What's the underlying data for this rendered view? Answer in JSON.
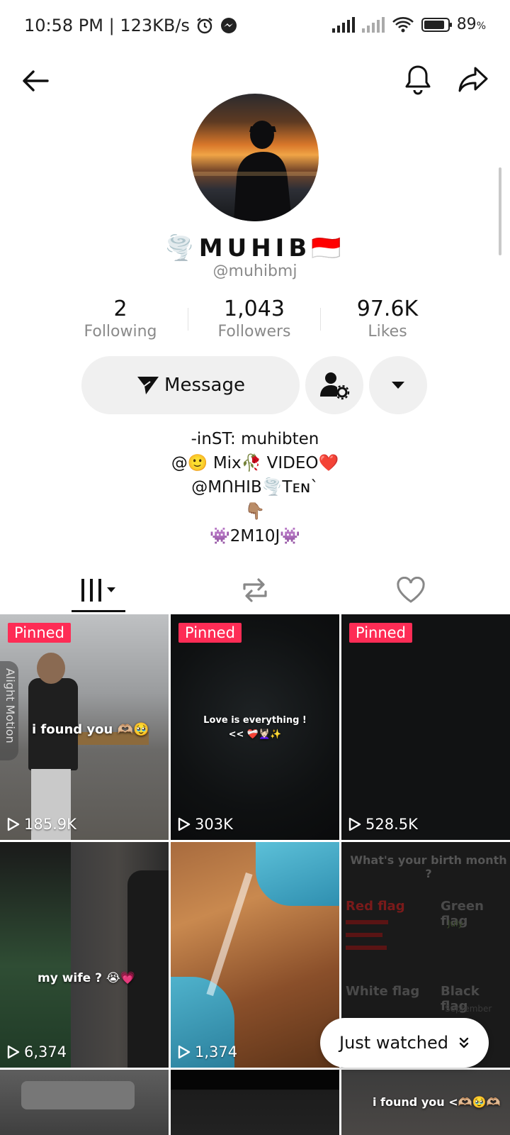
{
  "status_bar": {
    "time_speed": "10:58 PM | 123KB/s",
    "battery": "89",
    "battery_unit": "%",
    "battery_level": 0.89
  },
  "profile": {
    "display_name": "MUHIB",
    "name_prefix_emoji": "🌪️",
    "name_suffix_emoji": "🇮🇩",
    "username": "@muhibmj",
    "stats": [
      {
        "value": "2",
        "label": "Following"
      },
      {
        "value": "1,043",
        "label": "Followers"
      },
      {
        "value": "97.6K",
        "label": "Likes"
      }
    ],
    "message_label": "Message",
    "bio_lines": [
      "-inST: muhibten",
      "@🙂 Mix🥀 VIDEO❤️",
      "@MꓵHIB🌪️Tᴇɴ`",
      "👇🏽",
      "👾2M10J👾"
    ]
  },
  "tabs": [
    "videos-tab",
    "reposts-tab",
    "liked-tab"
  ],
  "videos": [
    {
      "pinned": "Pinned",
      "views": "185.9K",
      "caption": "i found you 🫶🏼🥹",
      "watermark": "Alight Motion"
    },
    {
      "pinned": "Pinned",
      "views": "303K",
      "caption": "Love is everything !",
      "caption2": "<< ❤️‍🩹💆🏻‍♀️✨"
    },
    {
      "pinned": "Pinned",
      "views": "528.5K",
      "caption": ""
    },
    {
      "pinned": "",
      "views": "6,374",
      "caption": "my wife ? 😭💗"
    },
    {
      "pinned": "",
      "views": "1,374",
      "caption": ""
    },
    {
      "pinned": "",
      "views": "",
      "caption": "What's your birth month ?",
      "labels": [
        "Red flag",
        "Green flag",
        "White flag",
        "Black flag",
        "July",
        "September"
      ]
    },
    {
      "pinned": "",
      "views": "",
      "caption": ""
    },
    {
      "pinned": "",
      "views": "",
      "caption": ""
    },
    {
      "pinned": "",
      "views": "",
      "caption": "i found you <🫶🏼🥹🫶🏼"
    }
  ],
  "just_watched_label": "Just watched",
  "colors": {
    "pinned": "#fe2c55",
    "button_bg": "#f0f0f0"
  }
}
